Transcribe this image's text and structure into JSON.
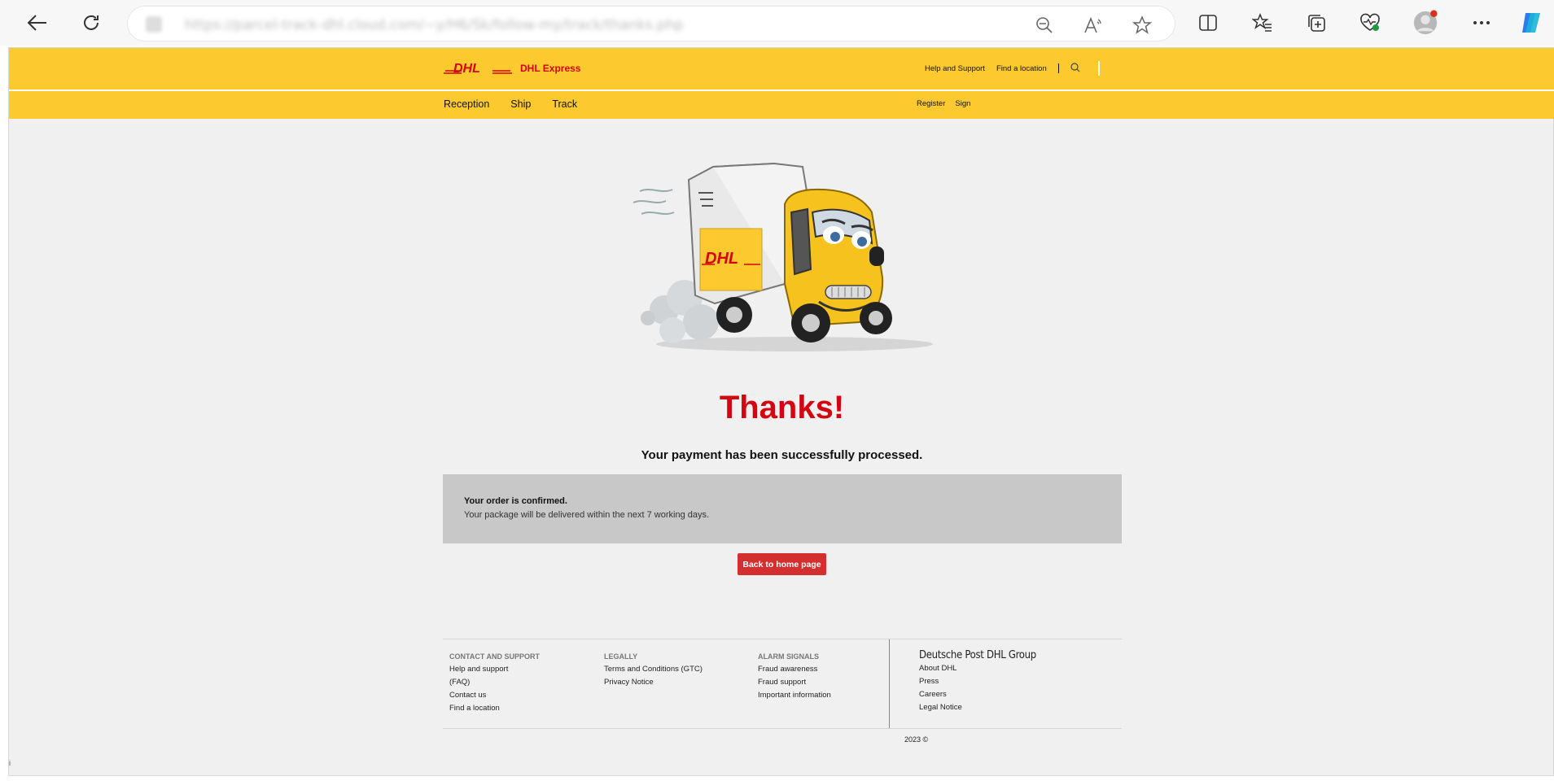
{
  "browser": {
    "url": "https://parcel-track-dhl.cloud.com/~y/H6/Sk/follow-my/track/thanks.php",
    "icons": [
      "back-arrow-icon",
      "refresh-icon",
      "zoom-out-icon",
      "read-aloud-icon",
      "favorite-star-icon",
      "split-screen-icon",
      "favorites-list-icon",
      "collections-icon",
      "health-icon",
      "profile-avatar-icon",
      "more-icon",
      "copilot-icon"
    ]
  },
  "header": {
    "logo_text": "DHL Express",
    "help_link": "Help and Support",
    "location_link": "Find a location",
    "nav": [
      "Reception",
      "Ship",
      "Track"
    ],
    "register": "Register",
    "sign": "Sign"
  },
  "main": {
    "heading": "Thanks!",
    "message": "Your payment has been successfully processed.",
    "confirm_title": "Your order is confirmed.",
    "confirm_text": "Your package will be delivered within the next 7 working days.",
    "back_button": "Back to home page"
  },
  "footer": {
    "col1": {
      "heading": "CONTACT AND SUPPORT",
      "items": [
        "Help and support",
        "(FAQ)",
        "Contact us",
        "Find a location"
      ]
    },
    "col2": {
      "heading": "LEGALLY",
      "items": [
        "Terms and Conditions (GTC)",
        "Privacy Notice"
      ]
    },
    "col3": {
      "heading": "ALARM SIGNALS",
      "items": [
        "Fraud awareness",
        "Fraud support",
        "Important information"
      ]
    },
    "group": {
      "name": "Deutsche Post DHL Group",
      "items": [
        "About DHL",
        "Press",
        "Careers",
        "Legal Notice"
      ]
    },
    "copyright": "2023 ©",
    "corner": "i"
  },
  "colors": {
    "dhl_yellow": "#fcc92f",
    "dhl_red": "#d40511",
    "button_red": "#d32f2f"
  }
}
